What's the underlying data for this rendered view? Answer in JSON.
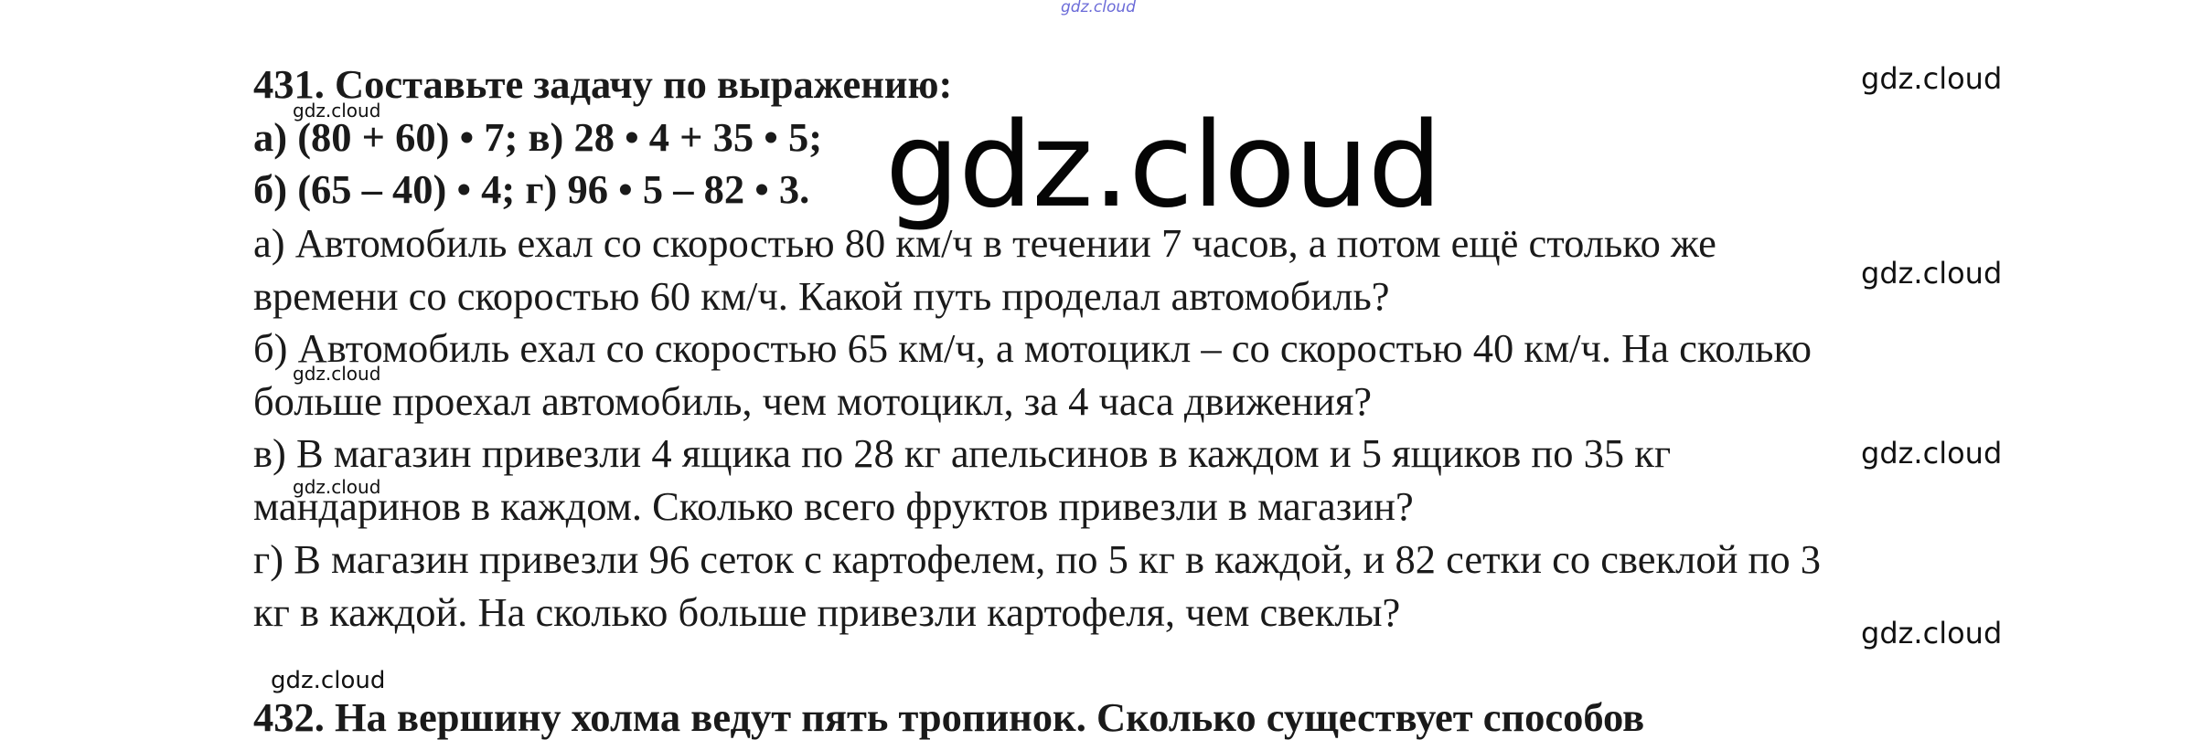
{
  "watermarks": {
    "top": "gdz.cloud",
    "big": "gdz.cloud",
    "right_1": "gdz.cloud",
    "right_2": "gdz.cloud",
    "right_3": "gdz.cloud",
    "right_4": "gdz.cloud",
    "small_1": "gdz.cloud",
    "small_2": "gdz.cloud",
    "small_3": "gdz.cloud",
    "bottom_left": "gdz.cloud"
  },
  "task431": {
    "title": "431. Составьте задачу по выражению:",
    "expr_line1": "а) (80 + 60) • 7; в) 28 • 4 + 35 • 5;",
    "expr_line2": "б) (65 – 40) • 4;  г) 96 • 5 – 82 • 3.",
    "a_line1": "а) Автомобиль ехал со скоростью 80 км/ч в течении 7 часов, а потом ещё столько же",
    "a_line2": "времени со скоростью 60 км/ч. Какой путь проделал автомобиль?",
    "b_line1": "б) Автомобиль ехал со скоростью 65 км/ч, а мотоцикл – со скоростью 40 км/ч. На сколько",
    "b_line2": "больше проехал автомобиль, чем мотоцикл, за 4 часа движения?",
    "v_line1": "в) В магазин привезли 4 ящика по 28 кг апельсинов в каждом и 5 ящиков по 35 кг",
    "v_line2": "мандаринов в каждом. Сколько всего фруктов привезли в магазин?",
    "g_line1": "г) В магазин привезли 96 сеток с картофелем, по 5 кг в каждой, и 82 сетки со свеклой по 3",
    "g_line2": "кг в каждой. На сколько больше привезли картофеля, чем свеклы?"
  },
  "task432": {
    "title": "432. На вершину холма ведут пять тропинок. Сколько существует способов"
  }
}
